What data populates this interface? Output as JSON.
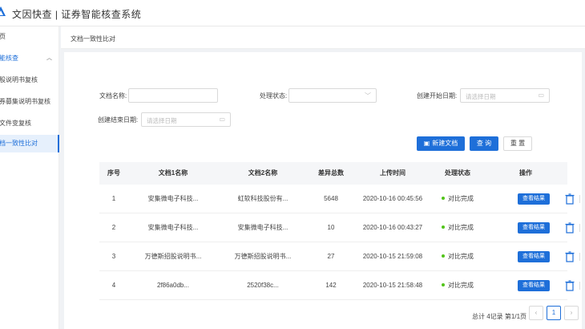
{
  "app": {
    "title": "文因快查 | 证券智能核查系统"
  },
  "sidebar": {
    "items": [
      {
        "label": "页"
      },
      {
        "label": "能核查"
      },
      {
        "label": "股说明书复核"
      },
      {
        "label": "券募集说明书复核"
      },
      {
        "label": "文件变复核"
      },
      {
        "label": "档一致性比对"
      }
    ]
  },
  "breadcrumb": "文档一致性比对",
  "filters": {
    "doc_name_label": "文档名称:",
    "doc_name_value": "",
    "status_label": "处理状态:",
    "status_value": "",
    "start_date_label": "创建开始日期:",
    "start_date_placeholder": "请选择日期",
    "end_date_label": "创建结束日期:",
    "end_date_placeholder": "请选择日期"
  },
  "actions": {
    "new_doc": "新建文档",
    "search": "查 询",
    "reset": "重 置"
  },
  "table": {
    "headers": [
      "序号",
      "文档1名称",
      "文档2名称",
      "差异总数",
      "上传时间",
      "处理状态",
      "操作"
    ],
    "rows": [
      {
        "no": "1",
        "doc1": "安集微电子科技...",
        "doc2": "虹软科技股份有...",
        "diff": "5648",
        "time": "2020-10-16 00:45:56",
        "status": "对比完成",
        "action": "查看结果"
      },
      {
        "no": "2",
        "doc1": "安集微电子科技...",
        "doc2": "安集微电子科技...",
        "diff": "10",
        "time": "2020-10-16 00:43:27",
        "status": "对比完成",
        "action": "查看结果"
      },
      {
        "no": "3",
        "doc1": "万德斯招股说明书...",
        "doc2": "万德斯招股说明书...",
        "diff": "27",
        "time": "2020-10-15 21:59:08",
        "status": "对比完成",
        "action": "查看结果"
      },
      {
        "no": "4",
        "doc1": "2f86a0db...",
        "doc2": "2520f38c...",
        "diff": "142",
        "time": "2020-10-15 21:58:48",
        "status": "对比完成",
        "action": "查看结果"
      }
    ]
  },
  "pagination": {
    "summary": "总计 4记录 第1/1页",
    "current": "1",
    "prev": "‹",
    "next": "›"
  },
  "colors": {
    "accent": "#1e6fd9",
    "success": "#52c41a"
  }
}
